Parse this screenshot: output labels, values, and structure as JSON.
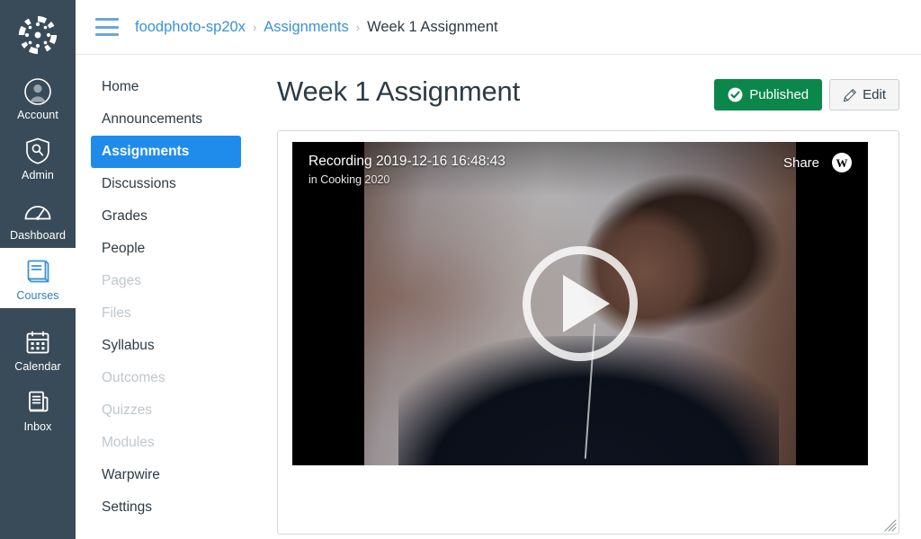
{
  "global_nav": {
    "logo_name": "canvas-logo",
    "items": [
      {
        "id": "account",
        "label": "Account",
        "icon": "user-avatar-icon",
        "active": false
      },
      {
        "id": "admin",
        "label": "Admin",
        "icon": "shield-wrench-icon",
        "active": false
      },
      {
        "id": "dashboard",
        "label": "Dashboard",
        "icon": "dashboard-gauge-icon",
        "active": false
      },
      {
        "id": "courses",
        "label": "Courses",
        "icon": "book-icon",
        "active": true
      },
      {
        "id": "calendar",
        "label": "Calendar",
        "icon": "calendar-icon",
        "active": false
      },
      {
        "id": "inbox",
        "label": "Inbox",
        "icon": "inbox-tray-icon",
        "active": false
      }
    ]
  },
  "topbar": {
    "menu_icon": "hamburger-menu-icon",
    "breadcrumb": [
      {
        "label": "foodphoto-sp20x",
        "current": false
      },
      {
        "label": "Assignments",
        "current": false
      },
      {
        "label": "Week 1 Assignment",
        "current": true
      }
    ],
    "separator": "›"
  },
  "course_nav": {
    "items": [
      {
        "label": "Home",
        "state": "normal"
      },
      {
        "label": "Announcements",
        "state": "normal"
      },
      {
        "label": "Assignments",
        "state": "active"
      },
      {
        "label": "Discussions",
        "state": "normal"
      },
      {
        "label": "Grades",
        "state": "normal"
      },
      {
        "label": "People",
        "state": "normal"
      },
      {
        "label": "Pages",
        "state": "muted"
      },
      {
        "label": "Files",
        "state": "muted"
      },
      {
        "label": "Syllabus",
        "state": "normal"
      },
      {
        "label": "Outcomes",
        "state": "muted"
      },
      {
        "label": "Quizzes",
        "state": "muted"
      },
      {
        "label": "Modules",
        "state": "muted"
      },
      {
        "label": "Warpwire",
        "state": "normal"
      },
      {
        "label": "Settings",
        "state": "normal"
      }
    ]
  },
  "main": {
    "page_title": "Week 1 Assignment",
    "publish_button": {
      "label": "Published",
      "icon": "check-circle-icon",
      "color": "#0b874b"
    },
    "edit_button": {
      "label": "Edit",
      "icon": "pencil-icon"
    },
    "video": {
      "title": "Recording 2019-12-16 16:48:43",
      "subtitle": "in Cooking 2020",
      "share_label": "Share",
      "provider_logo_letter": "W",
      "provider_logo_name": "warpwire-logo",
      "play_icon": "play-button-icon"
    },
    "resize_handle_name": "resize-grip"
  },
  "colors": {
    "nav_background": "#394B58",
    "link_blue": "#3a93d4",
    "active_nav_blue": "#1f8ceb",
    "published_green": "#0b874b",
    "text_dark": "#2d3b45",
    "muted_text": "#bfc7cc"
  }
}
